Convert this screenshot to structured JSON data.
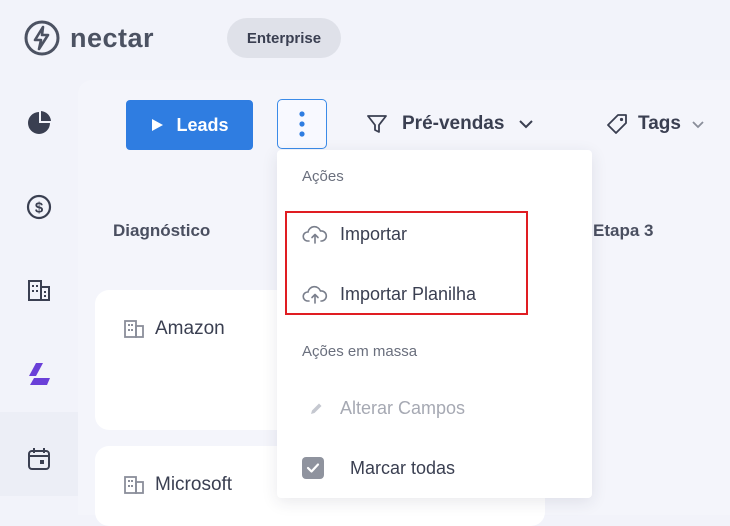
{
  "header": {
    "brand": "nectar",
    "plan_badge": "Enterprise"
  },
  "sidebar": {
    "items": [
      {
        "icon": "pie-chart-icon"
      },
      {
        "icon": "dollar-circle-icon"
      },
      {
        "icon": "building-icon"
      },
      {
        "icon": "pipeline-logo-icon",
        "active": true
      },
      {
        "icon": "calendar-icon"
      }
    ],
    "active_color": "#6a3fd8"
  },
  "toolbar": {
    "leads_label": "Leads",
    "pipeline_label": "Pré-vendas",
    "tags_label": "Tags"
  },
  "board": {
    "columns": [
      "Diagnóstico",
      "Etapa 3"
    ],
    "cards": [
      "Amazon",
      "Microsoft"
    ]
  },
  "menu": {
    "section_actions": "Ações",
    "import_label": "Importar",
    "import_sheet_label": "Importar Planilha",
    "section_bulk": "Ações em massa",
    "edit_fields_label": "Alterar Campos",
    "select_all_label": "Marcar todas"
  },
  "colors": {
    "accent": "#2f7de1",
    "highlight": "#e01d22"
  }
}
